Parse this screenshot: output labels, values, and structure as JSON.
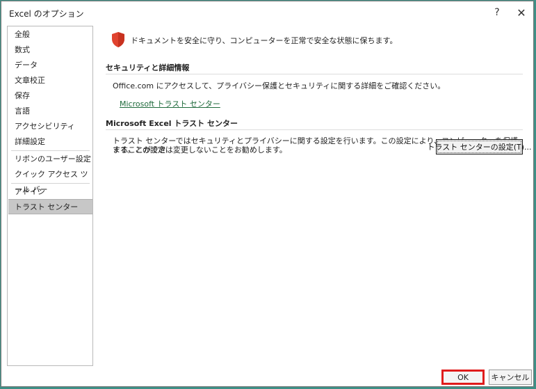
{
  "window": {
    "title": "Excel のオプション",
    "help_label": "?",
    "close_label": "✕"
  },
  "sidebar": {
    "items": [
      {
        "label": "全般"
      },
      {
        "label": "数式"
      },
      {
        "label": "データ"
      },
      {
        "label": "文章校正"
      },
      {
        "label": "保存"
      },
      {
        "label": "言語"
      },
      {
        "label": "アクセシビリティ"
      },
      {
        "label": "詳細設定"
      },
      {
        "label": "リボンのユーザー設定"
      },
      {
        "label": "クイック アクセス ツール バー"
      },
      {
        "label": "アドイン"
      },
      {
        "label": "トラスト センター",
        "selected": true
      }
    ]
  },
  "main": {
    "intro": "ドキュメントを安全に守り、コンピューターを正常で安全な状態に保ちます。",
    "security_section": {
      "heading": "セキュリティと詳細情報",
      "text": "Office.com にアクセスして、プライバシー保護とセキュリティに関する詳細をご確認ください。",
      "link": "Microsoft トラスト センター"
    },
    "trust_section": {
      "heading": "Microsoft Excel トラスト センター",
      "text_line1": "トラスト センターではセキュリティとプライバシーに関する設定を行います。この設定により、コンピューターを保護することができ",
      "text_line2": "ます。この設定は変更しないことをお勧めします。",
      "button": "トラスト センターの設定(T)..."
    }
  },
  "footer": {
    "ok": "OK",
    "cancel": "キャンセル"
  },
  "colors": {
    "shield": "#e0432f",
    "link": "#1f6b3c",
    "ok_highlight": "#e01c1c",
    "selected_item": "#c7c7c7"
  }
}
